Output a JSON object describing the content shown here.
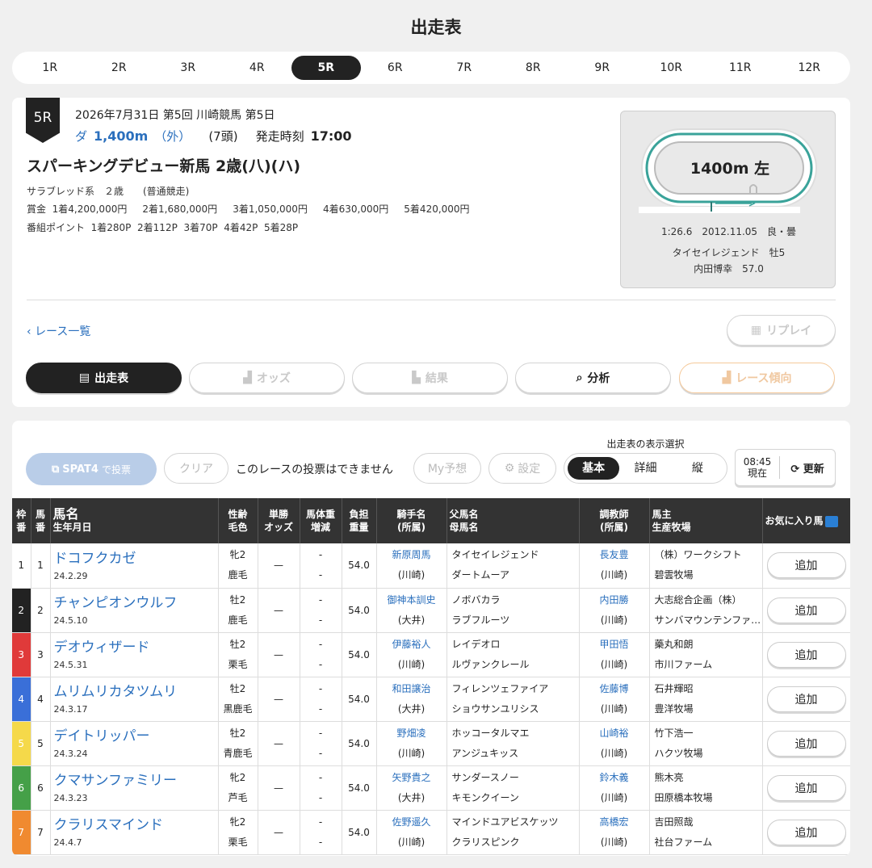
{
  "page_title": "出走表",
  "race_tabs": [
    "1R",
    "2R",
    "3R",
    "4R",
    "5R",
    "6R",
    "7R",
    "8R",
    "9R",
    "10R",
    "11R",
    "12R"
  ],
  "active_race": "5R",
  "race": {
    "badge": "5R",
    "date_line": "2026年7月31日  第5回 川崎競馬 第5日",
    "track_type": "ダ",
    "distance": "1,400m",
    "surface": "（外）",
    "heads": "(7頭)",
    "start_label": "発走時刻",
    "start_time": "17:00",
    "name": "スパーキングデビュー新馬 2歳(八)(ハ)",
    "breed_line": "サラブレッド系　２歳　　(普通競走)",
    "prize_line": "賞金  1着4,200,000円     2着1,680,000円     3着1,050,000円     4着630,000円     5着420,000円",
    "points_line": "番組ポイント  1着280P  2着112P  3着70P  4着42P  5着28P"
  },
  "course": {
    "label": "1400m 左",
    "record_time": "1:26.6　2012.11.05　良・曇",
    "record_horse": "タイセイレジェンド　牡5",
    "record_jockey": "内田博幸　57.0"
  },
  "back_link": "レース一覧",
  "replay_label": "リプレイ",
  "nav_buttons": {
    "entries": "出走表",
    "odds": "オッズ",
    "results": "結果",
    "analysis": "分析",
    "trend": "レース傾向"
  },
  "toolbar": {
    "spat4": "SPAT4",
    "spat4_suffix": "で投票",
    "clear": "クリア",
    "no_vote": "このレースの投票はできません",
    "my_pick": "My予想",
    "settings": "設定",
    "view_caption": "出走表の表示選択",
    "view_options": [
      "基本",
      "詳細",
      "縦"
    ],
    "update_time": "08:45",
    "update_now": "現在",
    "update": "更新"
  },
  "table_headers": {
    "waku": "枠番",
    "uma": "馬番",
    "horse": "馬名",
    "birth": "生年月日",
    "sex_age": "性齢",
    "coat": "毛色",
    "odds_a": "単勝",
    "odds_b": "オッズ",
    "weight_a": "馬体重",
    "weight_b": "増減",
    "burden_a": "負担",
    "burden_b": "重量",
    "jockey": "騎手名",
    "jockey_aff": "(所属)",
    "sire": "父馬名",
    "dam": "母馬名",
    "trainer": "調教師",
    "trainer_aff": "(所属)",
    "owner": "馬主",
    "breeder": "生産牧場",
    "fav": "お気に入り馬"
  },
  "entries": [
    {
      "waku": "1",
      "uma": "1",
      "waku_color": "#ffffff",
      "waku_text": "#222222",
      "name": "ドコフクカゼ",
      "birth": "24.2.29",
      "sex_age": "牝2",
      "coat": "鹿毛",
      "odds": "—",
      "wt": "-",
      "wt_diff": "-",
      "burden": "54.0",
      "jockey": "新原周馬",
      "jockey_aff": "(川崎)",
      "sire": "タイセイレジェンド",
      "dam": "ダートムーア",
      "trainer": "長友豊",
      "trainer_aff": "(川崎)",
      "owner": "（株）ワークシフト",
      "breeder": "碧雲牧場",
      "fav": "追加"
    },
    {
      "waku": "2",
      "uma": "2",
      "waku_color": "#222222",
      "waku_text": "#ffffff",
      "name": "チャンピオンウルフ",
      "birth": "24.5.10",
      "sex_age": "牡2",
      "coat": "鹿毛",
      "odds": "—",
      "wt": "-",
      "wt_diff": "-",
      "burden": "54.0",
      "jockey": "御神本訓史",
      "jockey_aff": "(大井)",
      "sire": "ノボバカラ",
      "dam": "ラブフルーツ",
      "trainer": "内田勝",
      "trainer_aff": "(川崎)",
      "owner": "大志総合企画（株）",
      "breeder": "サンバマウンテンファーム",
      "fav": "追加"
    },
    {
      "waku": "3",
      "uma": "3",
      "waku_color": "#e03a3a",
      "waku_text": "#ffffff",
      "name": "デオウィザード",
      "birth": "24.5.31",
      "sex_age": "牡2",
      "coat": "栗毛",
      "odds": "—",
      "wt": "-",
      "wt_diff": "-",
      "burden": "54.0",
      "jockey": "伊藤裕人",
      "jockey_aff": "(川崎)",
      "sire": "レイデオロ",
      "dam": "ルヴァンクレール",
      "trainer": "甲田悟",
      "trainer_aff": "(川崎)",
      "owner": "藥丸和朗",
      "breeder": "市川ファーム",
      "fav": "追加"
    },
    {
      "waku": "4",
      "uma": "4",
      "waku_color": "#3a6fd8",
      "waku_text": "#ffffff",
      "name": "ムリムリカタツムリ",
      "birth": "24.3.17",
      "sex_age": "牡2",
      "coat": "黒鹿毛",
      "odds": "—",
      "wt": "-",
      "wt_diff": "-",
      "burden": "54.0",
      "jockey": "和田譲治",
      "jockey_aff": "(大井)",
      "sire": "フィレンツェファイア",
      "dam": "ショウサンユリシス",
      "trainer": "佐藤博",
      "trainer_aff": "(川崎)",
      "owner": "石井輝昭",
      "breeder": "豊洋牧場",
      "fav": "追加"
    },
    {
      "waku": "5",
      "uma": "5",
      "waku_color": "#f5d94a",
      "waku_text": "#ffffff",
      "name": "デイトリッパー",
      "birth": "24.3.24",
      "sex_age": "牡2",
      "coat": "青鹿毛",
      "odds": "—",
      "wt": "-",
      "wt_diff": "-",
      "burden": "54.0",
      "jockey": "野畑凌",
      "jockey_aff": "(川崎)",
      "sire": "ホッコータルマエ",
      "dam": "アンジュキッス",
      "trainer": "山崎裕",
      "trainer_aff": "(川崎)",
      "owner": "竹下浩一",
      "breeder": "ハクツ牧場",
      "fav": "追加"
    },
    {
      "waku": "6",
      "uma": "6",
      "waku_color": "#45a048",
      "waku_text": "#ffffff",
      "name": "クマサンファミリー",
      "birth": "24.3.23",
      "sex_age": "牝2",
      "coat": "芦毛",
      "odds": "—",
      "wt": "-",
      "wt_diff": "-",
      "burden": "54.0",
      "jockey": "矢野貴之",
      "jockey_aff": "(大井)",
      "sire": "サンダースノー",
      "dam": "キモンクイーン",
      "trainer": "鈴木義",
      "trainer_aff": "(川崎)",
      "owner": "熊木亮",
      "breeder": "田原橋本牧場",
      "fav": "追加"
    },
    {
      "waku": "7",
      "uma": "7",
      "waku_color": "#f08a30",
      "waku_text": "#ffffff",
      "name": "クラリスマインド",
      "birth": "24.4.7",
      "sex_age": "牝2",
      "coat": "栗毛",
      "odds": "—",
      "wt": "-",
      "wt_diff": "-",
      "burden": "54.0",
      "jockey": "佐野遥久",
      "jockey_aff": "(川崎)",
      "sire": "マインドユアビスケッツ",
      "dam": "クラリスピンク",
      "trainer": "高橋宏",
      "trainer_aff": "(川崎)",
      "owner": "吉田照哉",
      "breeder": "社台ファーム",
      "fav": "追加"
    }
  ]
}
